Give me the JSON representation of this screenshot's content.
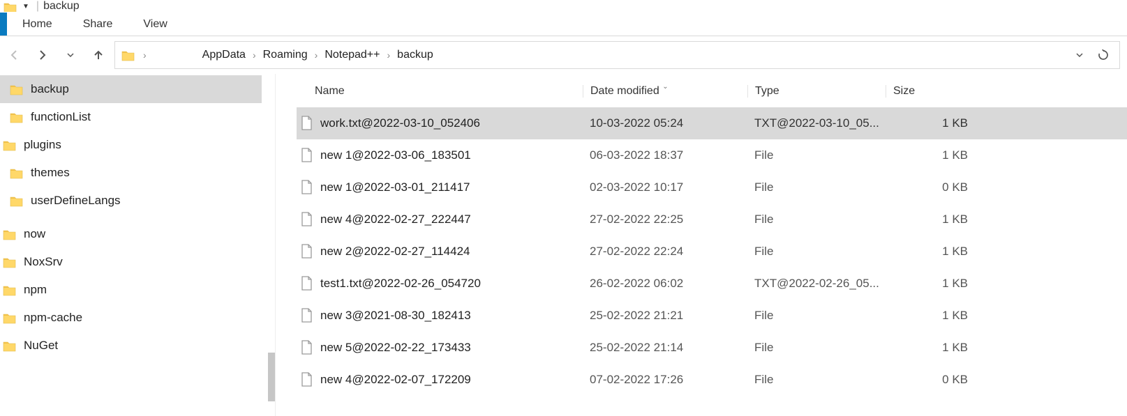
{
  "titlebar": {
    "title": "backup"
  },
  "ribbon": {
    "tabs": [
      "Home",
      "Share",
      "View"
    ]
  },
  "breadcrumb": [
    "AppData",
    "Roaming",
    "Notepad++",
    "backup"
  ],
  "columns": {
    "name": "Name",
    "date": "Date modified",
    "type": "Type",
    "size": "Size"
  },
  "sidebar": {
    "items": [
      {
        "label": "backup",
        "level": 1,
        "selected": true
      },
      {
        "label": "functionList",
        "level": 1,
        "selected": false
      },
      {
        "label": "plugins",
        "level": 0,
        "selected": false
      },
      {
        "label": "themes",
        "level": 1,
        "selected": false
      },
      {
        "label": "userDefineLangs",
        "level": 1,
        "selected": false
      },
      {
        "label": "now",
        "level": 0,
        "selected": false
      },
      {
        "label": "NoxSrv",
        "level": 0,
        "selected": false
      },
      {
        "label": "npm",
        "level": 0,
        "selected": false
      },
      {
        "label": "npm-cache",
        "level": 0,
        "selected": false
      },
      {
        "label": "NuGet",
        "level": 0,
        "selected": false
      }
    ]
  },
  "files": [
    {
      "name": "work.txt@2022-03-10_052406",
      "date": "10-03-2022 05:24",
      "type": "TXT@2022-03-10_05...",
      "size": "1 KB",
      "selected": true
    },
    {
      "name": "new 1@2022-03-06_183501",
      "date": "06-03-2022 18:37",
      "type": "File",
      "size": "1 KB",
      "selected": false
    },
    {
      "name": "new 1@2022-03-01_211417",
      "date": "02-03-2022 10:17",
      "type": "File",
      "size": "0 KB",
      "selected": false
    },
    {
      "name": "new 4@2022-02-27_222447",
      "date": "27-02-2022 22:25",
      "type": "File",
      "size": "1 KB",
      "selected": false
    },
    {
      "name": "new 2@2022-02-27_114424",
      "date": "27-02-2022 22:24",
      "type": "File",
      "size": "1 KB",
      "selected": false
    },
    {
      "name": "test1.txt@2022-02-26_054720",
      "date": "26-02-2022 06:02",
      "type": "TXT@2022-02-26_05...",
      "size": "1 KB",
      "selected": false
    },
    {
      "name": "new 3@2021-08-30_182413",
      "date": "25-02-2022 21:21",
      "type": "File",
      "size": "1 KB",
      "selected": false
    },
    {
      "name": "new 5@2022-02-22_173433",
      "date": "25-02-2022 21:14",
      "type": "File",
      "size": "1 KB",
      "selected": false
    },
    {
      "name": "new 4@2022-02-07_172209",
      "date": "07-02-2022 17:26",
      "type": "File",
      "size": "0 KB",
      "selected": false
    }
  ]
}
